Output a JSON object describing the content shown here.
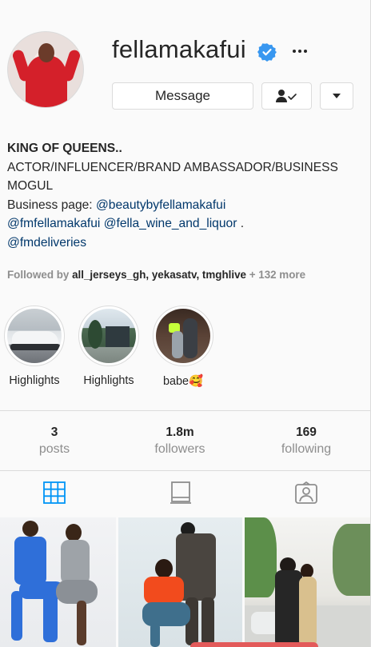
{
  "profile": {
    "username": "fellamakafui",
    "message_label": "Message"
  },
  "bio": {
    "name": "KING OF QUEENS..",
    "lines": [
      "ACTOR/INFLUENCER/BRAND AMBASSADOR/BUSINESS",
      "MOGUL"
    ],
    "business_prefix": "Business page: ",
    "business_link": "@beautybyfellamakafui",
    "link_1": "@fmfellamakafui",
    "link_2": "@fella_wine_and_liquor",
    "link_2_suffix": " .",
    "link_3": "@fmdeliveries"
  },
  "followed_by": {
    "prefix": "Followed by ",
    "users": [
      "all_jerseys_gh",
      "yekasatv",
      "tmghlive"
    ],
    "separator": ", ",
    "more": " + 132 more"
  },
  "highlights": [
    {
      "label": "Highlights"
    },
    {
      "label": "Highlights"
    },
    {
      "label": "babe🥰"
    }
  ],
  "stats": {
    "posts": {
      "count": "3",
      "label": "posts"
    },
    "followers": {
      "count": "1.8m",
      "label": "followers"
    },
    "following": {
      "count": "169",
      "label": "following"
    }
  },
  "tabs": [
    "grid-icon",
    "igtv-icon",
    "tagged-icon"
  ],
  "colors": {
    "accent": "#0095f6",
    "link": "#00376b",
    "verified": "#3897f0",
    "muted": "#8e8e8e",
    "border": "#dbdbdb"
  }
}
